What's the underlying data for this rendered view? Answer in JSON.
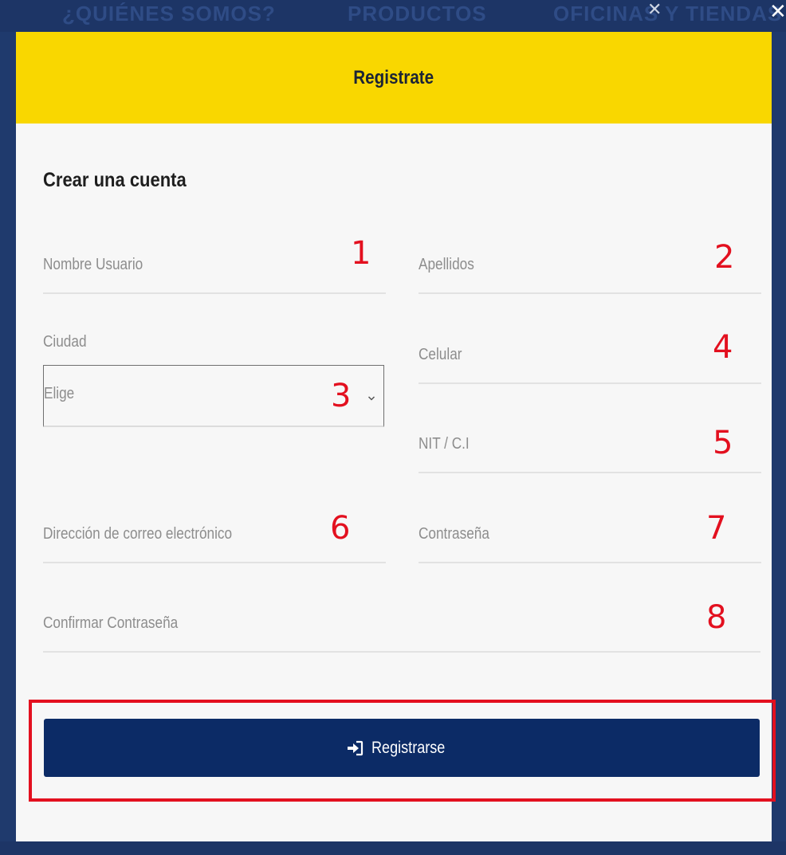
{
  "background_nav": {
    "items": [
      "¿QUIÉNES SOMOS?",
      "PRODUCTOS",
      "OFICINAS Y TIENDAS"
    ]
  },
  "modal": {
    "title": "Registrate",
    "section_title": "Crear una cuenta",
    "fields": {
      "nombre_usuario": {
        "label": "Nombre Usuario",
        "annotation": "1"
      },
      "apellidos": {
        "label": "Apellidos",
        "annotation": "2"
      },
      "ciudad": {
        "label": "Ciudad",
        "selected": "Elige",
        "annotation": "3"
      },
      "celular": {
        "label": "Celular",
        "annotation": "4"
      },
      "nit_ci": {
        "label": "NIT / C.I",
        "annotation": "5"
      },
      "email": {
        "label": "Dirección de correo electrónico",
        "annotation": "6"
      },
      "contrasena": {
        "label": "Contraseña",
        "annotation": "7"
      },
      "confirmar_contrasena": {
        "label": "Confirmar Contraseña",
        "annotation": "8"
      }
    },
    "submit": {
      "label": "Registrarse",
      "icon": "sign-in-icon"
    }
  },
  "colors": {
    "header_yellow": "#f9d700",
    "button_navy": "#0c2b66",
    "annotation_red": "#e3101f",
    "modal_bg": "#f7f7f7"
  }
}
